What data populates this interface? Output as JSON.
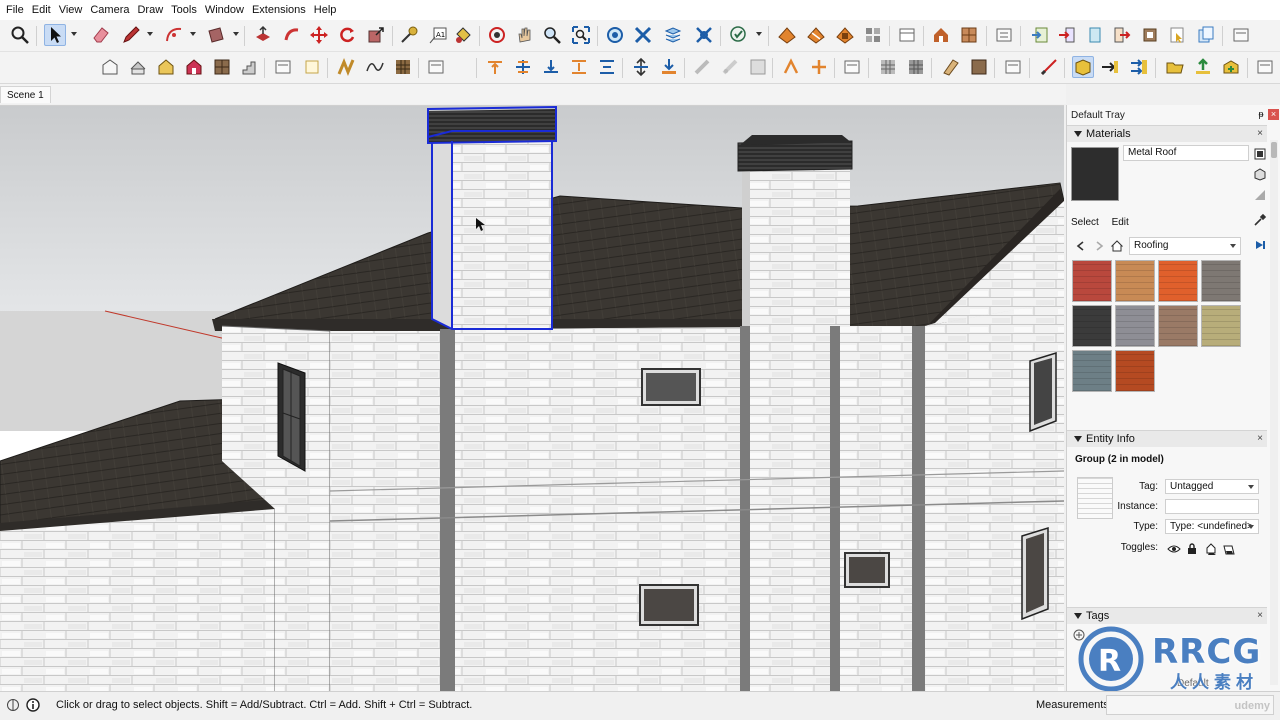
{
  "menu": [
    "File",
    "Edit",
    "View",
    "Camera",
    "Draw",
    "Tools",
    "Window",
    "Extensions",
    "Help"
  ],
  "scene_tab": "Scene 1",
  "tray": {
    "title": "Default Tray",
    "pin": "ᵽ",
    "close": "×",
    "materials": {
      "header": "Materials",
      "current_material": "Metal Roof",
      "tabs": [
        "Select",
        "Edit"
      ],
      "library": "Roofing",
      "swatches": [
        {
          "name": "roof-red-metal",
          "color": "#b9483d"
        },
        {
          "name": "roof-shingle-tan",
          "color": "#c88a55"
        },
        {
          "name": "roof-tile-orange",
          "color": "#e0602c"
        },
        {
          "name": "roof-slate-gray",
          "color": "#7e7873"
        },
        {
          "name": "roof-slate-dark",
          "color": "#3b3b3b"
        },
        {
          "name": "roof-shingle-gray",
          "color": "#8e8e95"
        },
        {
          "name": "roof-shake-brown",
          "color": "#9a7a66"
        },
        {
          "name": "roof-thatch-olive",
          "color": "#b8ad7a"
        },
        {
          "name": "roof-metal-blue-gray",
          "color": "#6d7f86"
        },
        {
          "name": "roof-spanish-tile",
          "color": "#b54a22"
        }
      ]
    },
    "entity_info": {
      "header": "Entity Info",
      "title": "Group (2 in model)",
      "tag_label": "Tag:",
      "tag_value": "Untagged",
      "instance_label": "Instance:",
      "instance_value": "",
      "type_label": "Type:",
      "type_value": "Type: <undefined>",
      "toggles_label": "Toggles:"
    },
    "tags": {
      "header": "Tags",
      "default_row": "Default"
    }
  },
  "status": {
    "hint": "Click or drag to select objects. Shift = Add/Subtract. Ctrl = Add. Shift + Ctrl = Subtract.",
    "measurements_label": "Measurements",
    "measurements_value": ""
  },
  "watermark": {
    "brand": "RRCG",
    "sub": "人人素材",
    "udemy": "udemy"
  },
  "colors": {
    "selection": "#1a2bd6",
    "roof": "#3a3631",
    "brick": "#efefef",
    "accent_orange": "#e8862a"
  }
}
